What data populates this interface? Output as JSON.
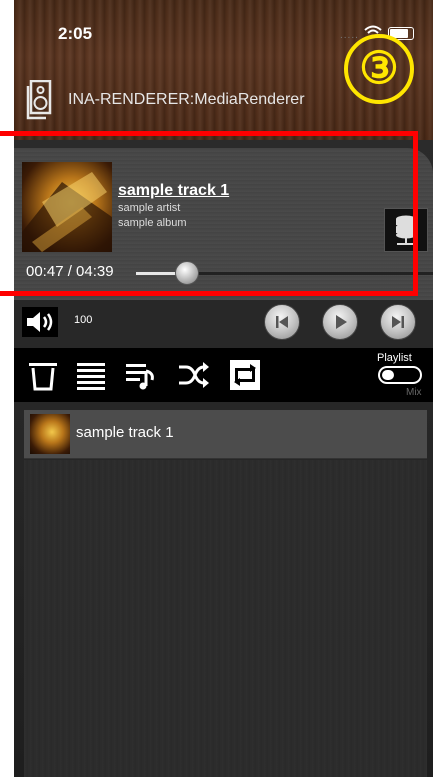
{
  "status_bar": {
    "time": "2:05",
    "dots": "....."
  },
  "step_badge": "③",
  "renderer": {
    "name": "INA-RENDERER:MediaRenderer"
  },
  "now_playing": {
    "title": "sample track 1",
    "artist": "sample artist",
    "album": "sample album",
    "time_display": "00:47 / 04:39",
    "progress_fraction": 0.168
  },
  "volume": {
    "value": "100"
  },
  "toolbar": {
    "playlist_label": "Playlist",
    "mix_label": "Mix"
  },
  "playlist": {
    "items": [
      {
        "title": "sample track 1"
      }
    ]
  },
  "colors": {
    "highlight": "#ff0000",
    "badge": "#ffe600",
    "wood": "#5b3520"
  }
}
